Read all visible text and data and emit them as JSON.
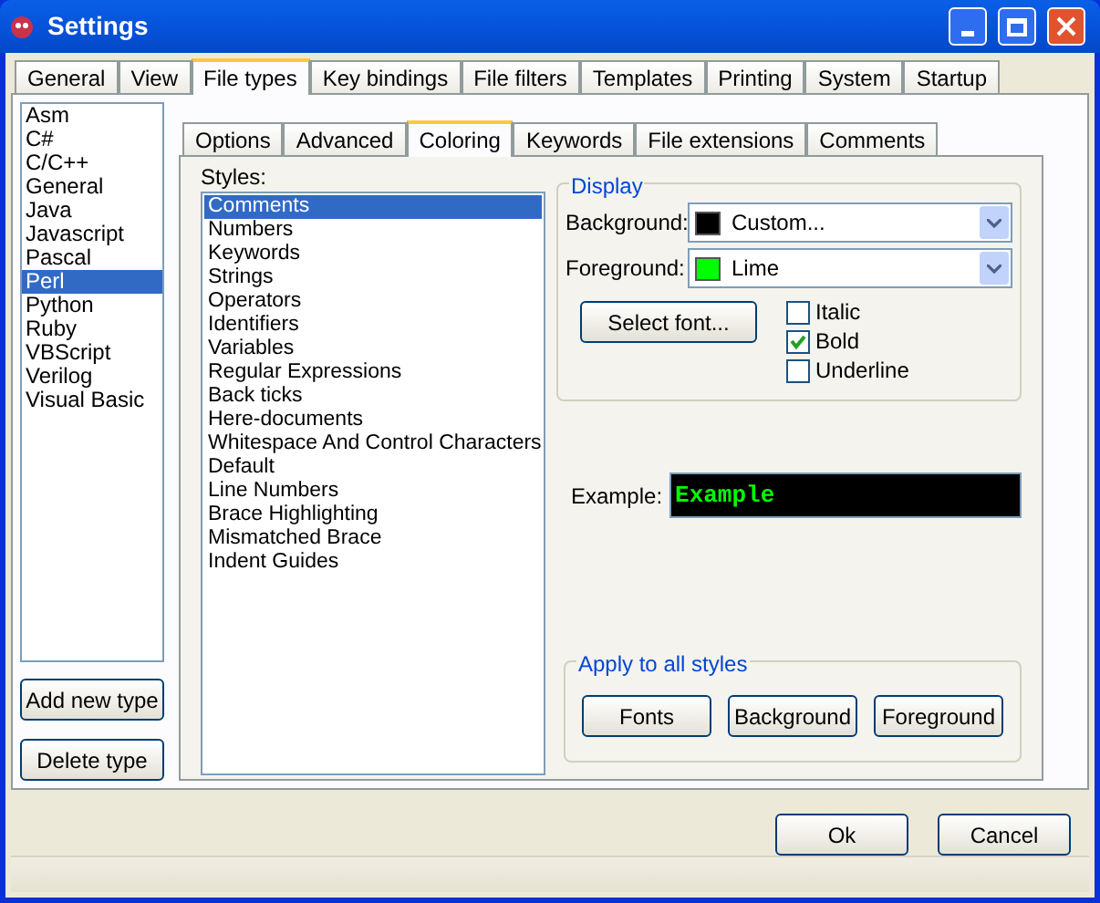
{
  "window": {
    "title": "Settings"
  },
  "tabs": [
    {
      "label": "General",
      "selected": false
    },
    {
      "label": "View",
      "selected": false
    },
    {
      "label": "File types",
      "selected": true
    },
    {
      "label": "Key bindings",
      "selected": false
    },
    {
      "label": "File filters",
      "selected": false
    },
    {
      "label": "Templates",
      "selected": false
    },
    {
      "label": "Printing",
      "selected": false
    },
    {
      "label": "System",
      "selected": false
    },
    {
      "label": "Startup",
      "selected": false
    }
  ],
  "file_types": [
    {
      "label": "Asm",
      "selected": false
    },
    {
      "label": "C#",
      "selected": false
    },
    {
      "label": "C/C++",
      "selected": false
    },
    {
      "label": "General",
      "selected": false
    },
    {
      "label": "Java",
      "selected": false
    },
    {
      "label": "Javascript",
      "selected": false
    },
    {
      "label": "Pascal",
      "selected": false
    },
    {
      "label": "Perl",
      "selected": true
    },
    {
      "label": "Python",
      "selected": false
    },
    {
      "label": "Ruby",
      "selected": false
    },
    {
      "label": "VBScript",
      "selected": false
    },
    {
      "label": "Verilog",
      "selected": false
    },
    {
      "label": "Visual Basic",
      "selected": false
    }
  ],
  "type_buttons": [
    "Add new type",
    "Delete type"
  ],
  "sub_tabs": [
    {
      "label": "Options",
      "selected": false
    },
    {
      "label": "Advanced",
      "selected": false
    },
    {
      "label": "Coloring",
      "selected": true
    },
    {
      "label": "Keywords",
      "selected": false
    },
    {
      "label": "File extensions",
      "selected": false
    },
    {
      "label": "Comments",
      "selected": false
    }
  ],
  "styles": {
    "label": "Styles:",
    "items": [
      {
        "label": "Comments",
        "selected": true
      },
      {
        "label": "Numbers",
        "selected": false
      },
      {
        "label": "Keywords",
        "selected": false
      },
      {
        "label": "Strings",
        "selected": false
      },
      {
        "label": "Operators",
        "selected": false
      },
      {
        "label": "Identifiers",
        "selected": false
      },
      {
        "label": "Variables",
        "selected": false
      },
      {
        "label": "Regular Expressions",
        "selected": false
      },
      {
        "label": "Back ticks",
        "selected": false
      },
      {
        "label": "Here-documents",
        "selected": false
      },
      {
        "label": "Whitespace And Control Characters",
        "selected": false
      },
      {
        "label": "Default",
        "selected": false
      },
      {
        "label": "Line Numbers",
        "selected": false
      },
      {
        "label": "Brace Highlighting",
        "selected": false
      },
      {
        "label": "Mismatched Brace",
        "selected": false
      },
      {
        "label": "Indent Guides",
        "selected": false
      }
    ]
  },
  "display": {
    "title": "Display",
    "pickers": [
      {
        "label": "Background:",
        "value": "Custom...",
        "color": "#000000"
      },
      {
        "label": "Foreground:",
        "value": "Lime",
        "color": "#00ff00"
      }
    ],
    "select_font": "Select font...",
    "options": [
      {
        "label": "Italic",
        "checked": false
      },
      {
        "label": "Bold",
        "checked": true
      },
      {
        "label": "Underline",
        "checked": false
      }
    ]
  },
  "example": {
    "label": "Example:",
    "text": "Example"
  },
  "apply_all": {
    "title": "Apply to all styles",
    "buttons": [
      "Fonts",
      "Background",
      "Foreground"
    ]
  },
  "buttons": [
    "Ok",
    "Cancel"
  ]
}
